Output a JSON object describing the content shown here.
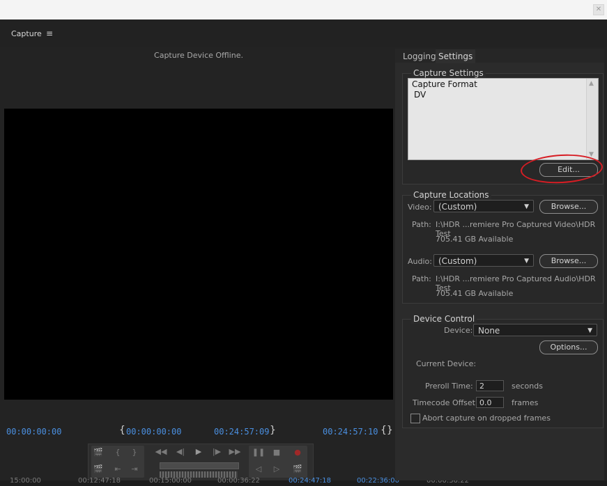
{
  "window": {
    "close_icon": "✕"
  },
  "panel": {
    "title": "Capture",
    "menu_icon": "≡"
  },
  "monitor": {
    "status": "Capture Device Offline.",
    "timecode_current": "00:00:00:00",
    "timecode_in": "00:00:00:00",
    "timecode_out": "00:24:57:09",
    "timecode_duration": "00:24:57:10",
    "bracket_in": "{",
    "bracket_out": "}",
    "bracket_inout": "{}",
    "timeline_labels": [
      "15:00:00",
      "00:12:47:18",
      "00:15:00:00",
      "00:00:36:22",
      "00:24:47:18",
      "00:22:36:00",
      "00:00:36:22"
    ]
  },
  "transport": {
    "colors": {
      "record": "#a02828"
    },
    "icons": {
      "mark_clip": "🎬",
      "set_in": "{",
      "set_out": "}",
      "scene_detect": "🎬",
      "goto_in": "⇤",
      "goto_out": "⇥",
      "rewind": "◀◀",
      "step_back": "◀|",
      "play": "▶",
      "step_fwd": "|▶",
      "fast_fwd": "▶▶",
      "pause": "❚❚",
      "stop": "■",
      "record": "●",
      "slow_rev": "◁",
      "slow_play": "▷"
    }
  },
  "tabs": {
    "logging": "Logging",
    "settings": "Settings"
  },
  "capture_settings": {
    "title": "Capture Settings",
    "format_label": "Capture Format",
    "format_value": "DV",
    "edit_button": "Edit...",
    "annotation_color": "#d71d24"
  },
  "capture_locations": {
    "title": "Capture Locations",
    "video_label": "Video:",
    "video_value": "(Custom)",
    "video_browse": "Browse...",
    "video_path_label": "Path:",
    "video_path": "I:\\HDR ...remiere Pro Captured Video\\HDR Test",
    "video_available": "705.41 GB Available",
    "audio_label": "Audio:",
    "audio_value": "(Custom)",
    "audio_browse": "Browse...",
    "audio_path_label": "Path:",
    "audio_path": "I:\\HDR ...remiere Pro Captured Audio\\HDR Test",
    "audio_available": "705.41 GB Available"
  },
  "device_control": {
    "title": "Device Control",
    "device_label": "Device:",
    "device_value": "None",
    "options_button": "Options...",
    "current_device_label": "Current Device:",
    "preroll_label": "Preroll Time:",
    "preroll_value": "2",
    "preroll_unit": "seconds",
    "offset_label": "Timecode Offset:",
    "offset_value": "0.0",
    "offset_unit": "frames",
    "abort_label": "Abort capture on dropped frames"
  }
}
